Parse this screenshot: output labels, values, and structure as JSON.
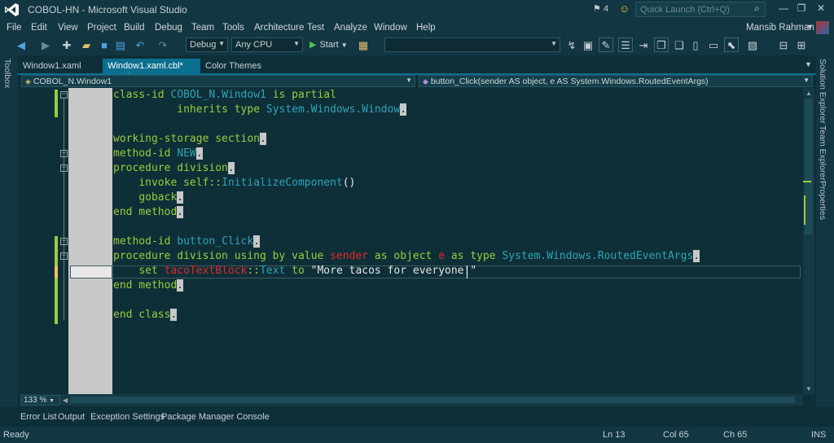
{
  "window": {
    "title": "COBOL-HN - Microsoft Visual Studio",
    "notification_count": "4",
    "quick_launch_placeholder": "Quick Launch (Ctrl+Q)"
  },
  "menu": {
    "items": [
      "File",
      "Edit",
      "View",
      "Project",
      "Build",
      "Debug",
      "Team",
      "Tools",
      "Architecture",
      "Test",
      "Analyze",
      "Window",
      "Help"
    ],
    "user_name": "Mansib Rahman"
  },
  "toolbar": {
    "configuration": "Debug",
    "platform": "Any CPU",
    "start_label": "Start"
  },
  "side_panels": {
    "left": "Toolbox",
    "right": [
      "Solution Explorer",
      "Team Explorer",
      "Properties"
    ]
  },
  "tabs": [
    {
      "label": "Window1.xaml"
    },
    {
      "label": "Window1.xaml.cbl*"
    },
    {
      "label": "Color Themes"
    }
  ],
  "navigation": {
    "class_scope": "COBOL_N.Window1",
    "member_scope": "button_Click(sender AS object, e AS System.Windows.RoutedEventArgs)"
  },
  "code": {
    "l1a": "class-id",
    "l1b": "COBOL_N.Window1",
    "l1c": "is partial",
    "l2a": "inherits type",
    "l2b": "System.Windows.Window",
    "l4": "working-storage section",
    "l5a": "method-id",
    "l5b": "NEW",
    "l6": "procedure division",
    "l7a": "invoke self",
    "l7b": "::",
    "l7c": "InitializeComponent",
    "l7d": "()",
    "l8": "goback",
    "l9": "end method",
    "l11a": "method-id",
    "l11b": "button_Click",
    "l12a": "procedure division using by value",
    "l12b": "sender",
    "l12c": "as object",
    "l12d": "e",
    "l12e": "as type",
    "l12f": "System.Windows.RoutedEventArgs",
    "l13a": "set",
    "l13b": "tacoTextBlock",
    "l13c": "::",
    "l13d": "Text",
    "l13e": "to",
    "l13f": "\"More tacos for everyone!\"",
    "l14": "end method",
    "l16": "end class",
    "period": "."
  },
  "editor": {
    "zoom": "133 %"
  },
  "tool_windows": [
    "Error List",
    "Output",
    "Exception Settings",
    "Package Manager Console"
  ],
  "status": {
    "state": "Ready",
    "line": "Ln 13",
    "col": "Col 65",
    "ch": "Ch 65",
    "mode": "INS"
  },
  "colors": {
    "background": "#0f2f38",
    "chrome": "#123642",
    "accent": "#0b6f8f",
    "keyword": "#9ccc3b",
    "type": "#2fa3b5",
    "highlight": "#e0282a"
  },
  "icons": [
    "vs-logo-icon",
    "flag-icon",
    "smiley-icon",
    "search-icon",
    "minimize-icon",
    "maximize-icon",
    "close-icon",
    "back-icon",
    "forward-icon",
    "new-project-icon",
    "open-icon",
    "save-icon",
    "save-all-icon",
    "undo-icon",
    "redo-icon",
    "play-icon",
    "pin-icon",
    "class-icon",
    "method-icon"
  ]
}
